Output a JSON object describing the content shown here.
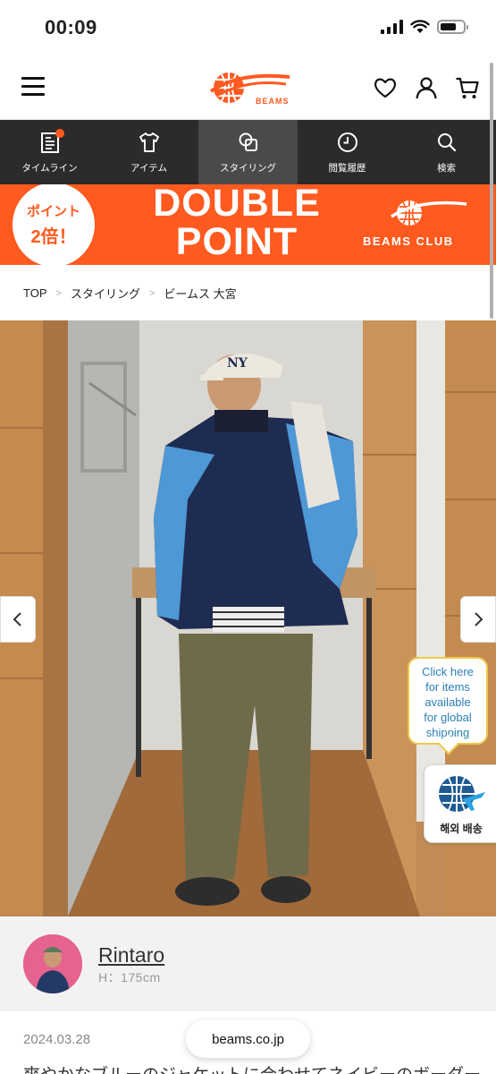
{
  "status_bar": {
    "time": "00:09"
  },
  "header": {
    "logo_text": "BEAMS"
  },
  "nav": {
    "items": [
      {
        "label": "タイムライン",
        "icon": "timeline-icon"
      },
      {
        "label": "アイテム",
        "icon": "tshirt-icon"
      },
      {
        "label": "スタイリング",
        "icon": "styling-icon"
      },
      {
        "label": "閲覧履歴",
        "icon": "history-icon"
      },
      {
        "label": "検索",
        "icon": "search-icon"
      }
    ],
    "active_index": 2
  },
  "banner": {
    "badge_line1": "ポイント",
    "badge_line2": "2倍！",
    "title_line1": "DOUBLE",
    "title_line2": "POINT",
    "brand": "BEAMS CLUB",
    "color": "#ff5a1f"
  },
  "breadcrumb": {
    "items": [
      "TOP",
      "スタイリング",
      "ビームス 大宮"
    ]
  },
  "global_shipping": {
    "bubble_lines": [
      "Click here",
      "for items",
      "available",
      "for global",
      "shipping"
    ],
    "button_label": "해외 배송"
  },
  "profile": {
    "name": "Rintaro",
    "height": "H：175cm"
  },
  "post": {
    "date": "2024.03.28",
    "description": "爽やかなブルーのジャケットに合わせてネイビーのボーダー"
  },
  "browser": {
    "url": "beams.co.jp"
  }
}
